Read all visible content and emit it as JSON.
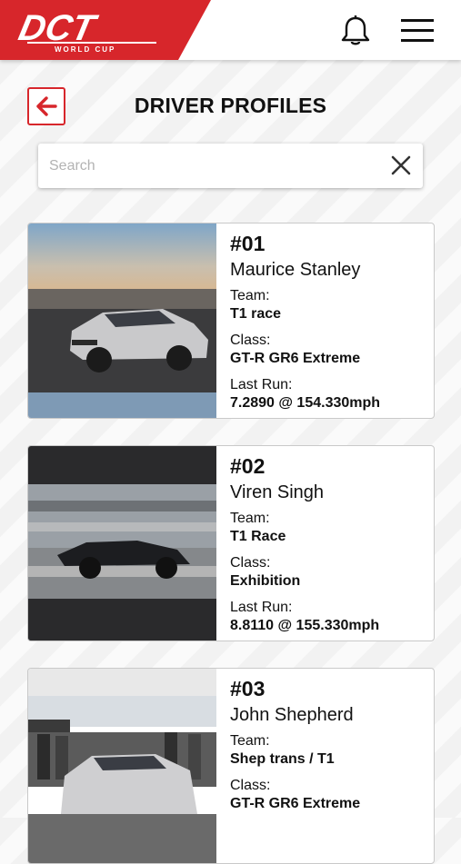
{
  "header": {
    "logo_text": "DCT",
    "logo_subtext": "WORLD CUP",
    "brand_color": "#d7262b",
    "icons": [
      "bell-icon",
      "hamburger-menu-icon"
    ]
  },
  "page": {
    "title": "DRIVER PROFILES",
    "back_icon": "arrow-left-icon"
  },
  "search": {
    "placeholder": "Search",
    "value": "",
    "clear_icon": "close-icon"
  },
  "labels": {
    "team": "Team:",
    "class": "Class:",
    "last_run": "Last Run:"
  },
  "drivers": [
    {
      "number": "#01",
      "name": "Maurice Stanley",
      "team": "T1 race",
      "class": "GT-R GR6 Extreme",
      "last_run": "7.2890 @ 154.330mph"
    },
    {
      "number": "#02",
      "name": "Viren Singh",
      "team": "T1 Race",
      "class": "Exhibition",
      "last_run": "8.8110 @ 155.330mph"
    },
    {
      "number": "#03",
      "name": "John Shepherd",
      "team": "Shep trans / T1",
      "class": "GT-R GR6 Extreme",
      "last_run": ""
    }
  ]
}
